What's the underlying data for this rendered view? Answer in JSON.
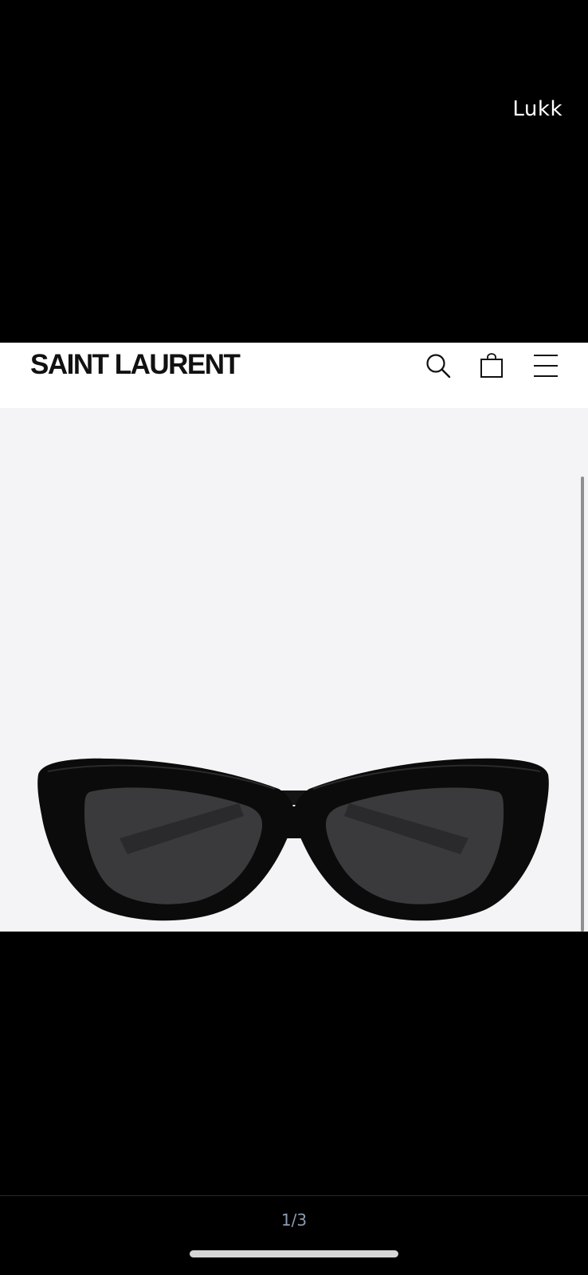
{
  "viewer": {
    "close_label": "Lukk",
    "page_counter": "1/3"
  },
  "screenshot": {
    "brand": "SAINT LAURENT",
    "icons": [
      "search-icon",
      "shopping-bag-icon",
      "menu-icon"
    ],
    "product": "black cat-eye sunglasses"
  },
  "colors": {
    "viewer_background": "#000000",
    "page_background": "#f4f4f6",
    "header_background": "#ffffff",
    "counter_text": "#8e9bb0"
  }
}
